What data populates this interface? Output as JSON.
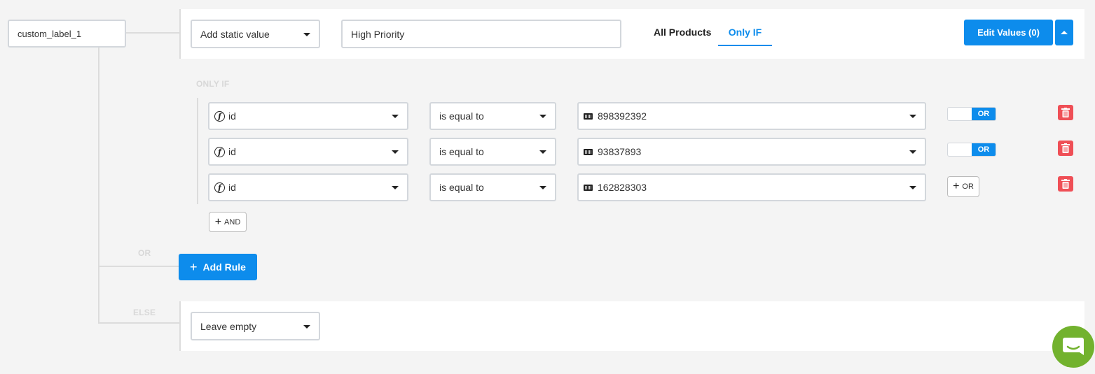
{
  "field": {
    "name": "custom_label_1"
  },
  "rule": {
    "action_select": "Add static value",
    "value_input": "High Priority",
    "tabs": [
      {
        "label": "All Products",
        "active": false
      },
      {
        "label": "Only IF",
        "active": true
      }
    ],
    "edit_values_label": "Edit Values (0)",
    "collapse_icon": "caret-up-icon"
  },
  "conditions": {
    "section_label": "ONLY IF",
    "rows": [
      {
        "field": "id",
        "field_icon": "function-icon",
        "operator": "is equal to",
        "value": "898392392",
        "value_icon": "keyboard-icon",
        "connector": "OR",
        "connector_type": "toggle"
      },
      {
        "field": "id",
        "field_icon": "function-icon",
        "operator": "is equal to",
        "value": "93837893",
        "value_icon": "keyboard-icon",
        "connector": "OR",
        "connector_type": "toggle"
      },
      {
        "field": "id",
        "field_icon": "function-icon",
        "operator": "is equal to",
        "value": "162828303",
        "value_icon": "keyboard-icon",
        "connector": "OR",
        "connector_type": "add-button"
      }
    ],
    "add_and_label": "AND"
  },
  "or_label": "OR",
  "add_rule_label": "Add Rule",
  "else": {
    "section_label": "ELSE",
    "action_select": "Leave empty"
  },
  "colors": {
    "accent": "#0d8cec",
    "danger": "#ef4f56",
    "chat": "#72b22e"
  }
}
